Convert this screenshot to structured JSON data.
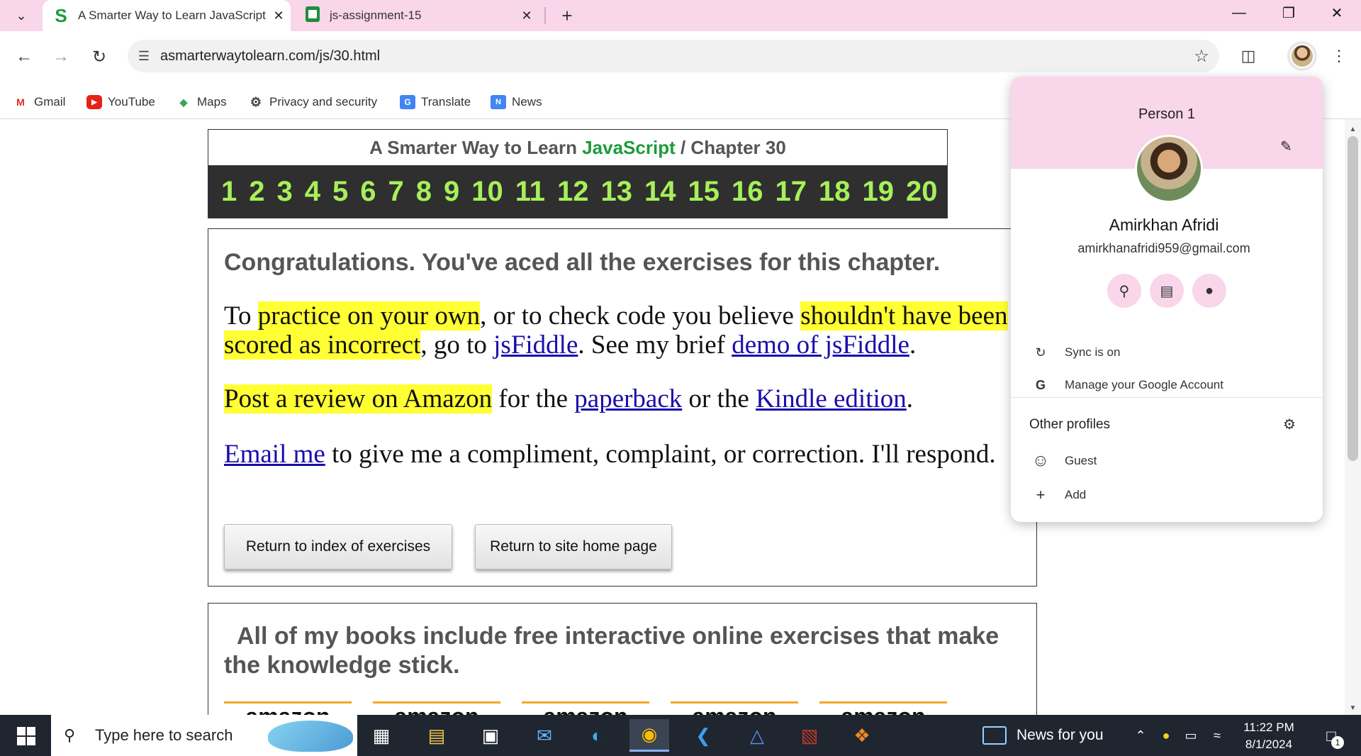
{
  "tabs": [
    {
      "title": "A Smarter Way to Learn JavaScript",
      "active": true
    },
    {
      "title": "js-assignment-15",
      "active": false
    }
  ],
  "new_tab_label": "+",
  "address_bar": {
    "url": "asmarterwaytolearn.com/js/30.html"
  },
  "bookmarks": [
    {
      "label": "Gmail",
      "icon": "gmail-icon"
    },
    {
      "label": "YouTube",
      "icon": "youtube-icon"
    },
    {
      "label": "Maps",
      "icon": "maps-icon"
    },
    {
      "label": "Privacy and security",
      "icon": "gear-icon"
    },
    {
      "label": "Translate",
      "icon": "translate-icon"
    },
    {
      "label": "News",
      "icon": "news-icon"
    }
  ],
  "page": {
    "header": {
      "title_prefix": "A Smarter Way to Learn ",
      "title_brand": "JavaScript",
      "title_suffix": " / Chapter 30",
      "chapters": [
        "1",
        "2",
        "3",
        "4",
        "5",
        "6",
        "7",
        "8",
        "9",
        "10",
        "11",
        "12",
        "13",
        "14",
        "15",
        "16",
        "17",
        "18",
        "19",
        "20"
      ]
    },
    "congrats": "Congratulations. You've aced all the exercises for this chapter.",
    "para1": {
      "t1": "To ",
      "h1": "practice on your own",
      "t2": ", or to check code you believe ",
      "h2": "shouldn't have been scored as incorrect",
      "t3": ", go to ",
      "l1": "jsFiddle",
      "t4": ". See my brief ",
      "l2": "demo of jsFiddle",
      "t5": "."
    },
    "para2": {
      "h1": "Post a review on Amazon",
      "t1": " for the ",
      "l1": "paperback",
      "t2": " or the ",
      "l2": "Kindle edition",
      "t3": "."
    },
    "para3": {
      "l1": "Email me",
      "t1": " to give me a compliment, complaint, or correction. I'll respond."
    },
    "buttons": {
      "return_index": "Return to index of exercises",
      "return_home": "Return to site home page"
    },
    "books_text": "All of my books include free interactive online exercises that make the knowledge stick.",
    "amazon_logos": [
      "amazon",
      "amazon",
      "amazon",
      "amazon",
      "amazon"
    ]
  },
  "profile_popup": {
    "person_label": "Person 1",
    "name": "Amirkhan Afridi",
    "email": "amirkhanafridi959@gmail.com",
    "sync_label": "Sync is on",
    "manage_label": "Manage your Google Account",
    "other_profiles_label": "Other profiles",
    "guest_label": "Guest",
    "add_label": "Add"
  },
  "taskbar": {
    "search_placeholder": "Type here to search",
    "news_label": "News for you",
    "time": "11:22 PM",
    "date": "8/1/2024",
    "notification_count": "1"
  },
  "colors": {
    "tab_strip": "#f9d6ea",
    "brand_green": "#1e9b3b",
    "chapter_numbers": "#a6f05a",
    "highlight": "#ffff33",
    "link": "#1a0dab",
    "taskbar": "#1f2630"
  }
}
